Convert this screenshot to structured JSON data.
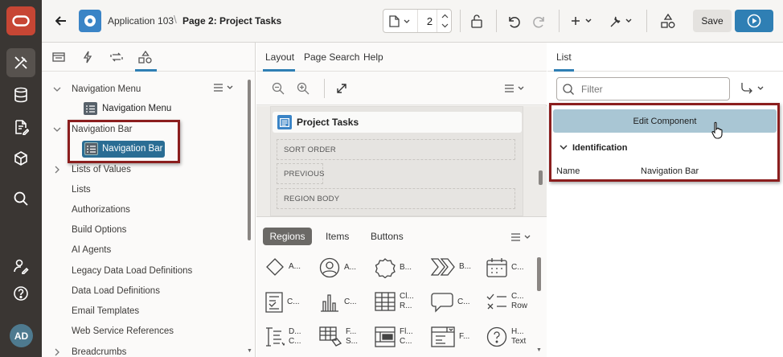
{
  "sidebar": {
    "avatar": "AD",
    "items": [
      "oracle-logo",
      "tools-icon",
      "database-icon",
      "document-edit-icon",
      "package-icon",
      "search-icon",
      "user-edit-icon",
      "help-icon"
    ]
  },
  "header": {
    "app_name": "Application 103",
    "page_title": "Page 2: Project Tasks",
    "page_number": "2",
    "save_label": "Save"
  },
  "left_panel": {
    "tree": [
      {
        "label": "Navigation Menu",
        "level": 0,
        "expanded": true
      },
      {
        "label": "Navigation Menu",
        "level": 1
      },
      {
        "label": "Navigation Bar",
        "level": 0,
        "expanded": true
      },
      {
        "label": "Navigation Bar",
        "level": 1,
        "selected": true
      },
      {
        "label": "Lists of Values",
        "level": 0,
        "collapsed": true
      },
      {
        "label": "Lists",
        "level": 0
      },
      {
        "label": "Authorizations",
        "level": 0
      },
      {
        "label": "Build Options",
        "level": 0
      },
      {
        "label": "AI Agents",
        "level": 0
      },
      {
        "label": "Legacy Data Load Definitions",
        "level": 0
      },
      {
        "label": "Data Load Definitions",
        "level": 0
      },
      {
        "label": "Email Templates",
        "level": 0
      },
      {
        "label": "Web Service References",
        "level": 0
      },
      {
        "label": "Breadcrumbs",
        "level": 0,
        "collapsed": true
      }
    ]
  },
  "middle_panel": {
    "tabs": [
      "Layout",
      "Page Search",
      "Help"
    ],
    "region_title": "Project Tasks",
    "slots": [
      "SORT ORDER",
      "PREVIOUS",
      "REGION BODY"
    ],
    "gallery_tabs": [
      "Regions",
      "Items",
      "Buttons"
    ],
    "components": [
      [
        "A...",
        "A...",
        "B...",
        "B...",
        "C..."
      ],
      [
        "C...",
        "C...",
        "Cl...\nR...",
        "C...",
        "C...\nRow"
      ],
      [
        "D...\nC...",
        "F...\nS...",
        "Fl...\nC...",
        "F...",
        "H...\nText"
      ]
    ]
  },
  "right_panel": {
    "tab": "List",
    "filter_placeholder": "Filter",
    "edit_button": "Edit Component",
    "section": "Identification",
    "property_name": "Name",
    "property_value": "Navigation Bar"
  }
}
